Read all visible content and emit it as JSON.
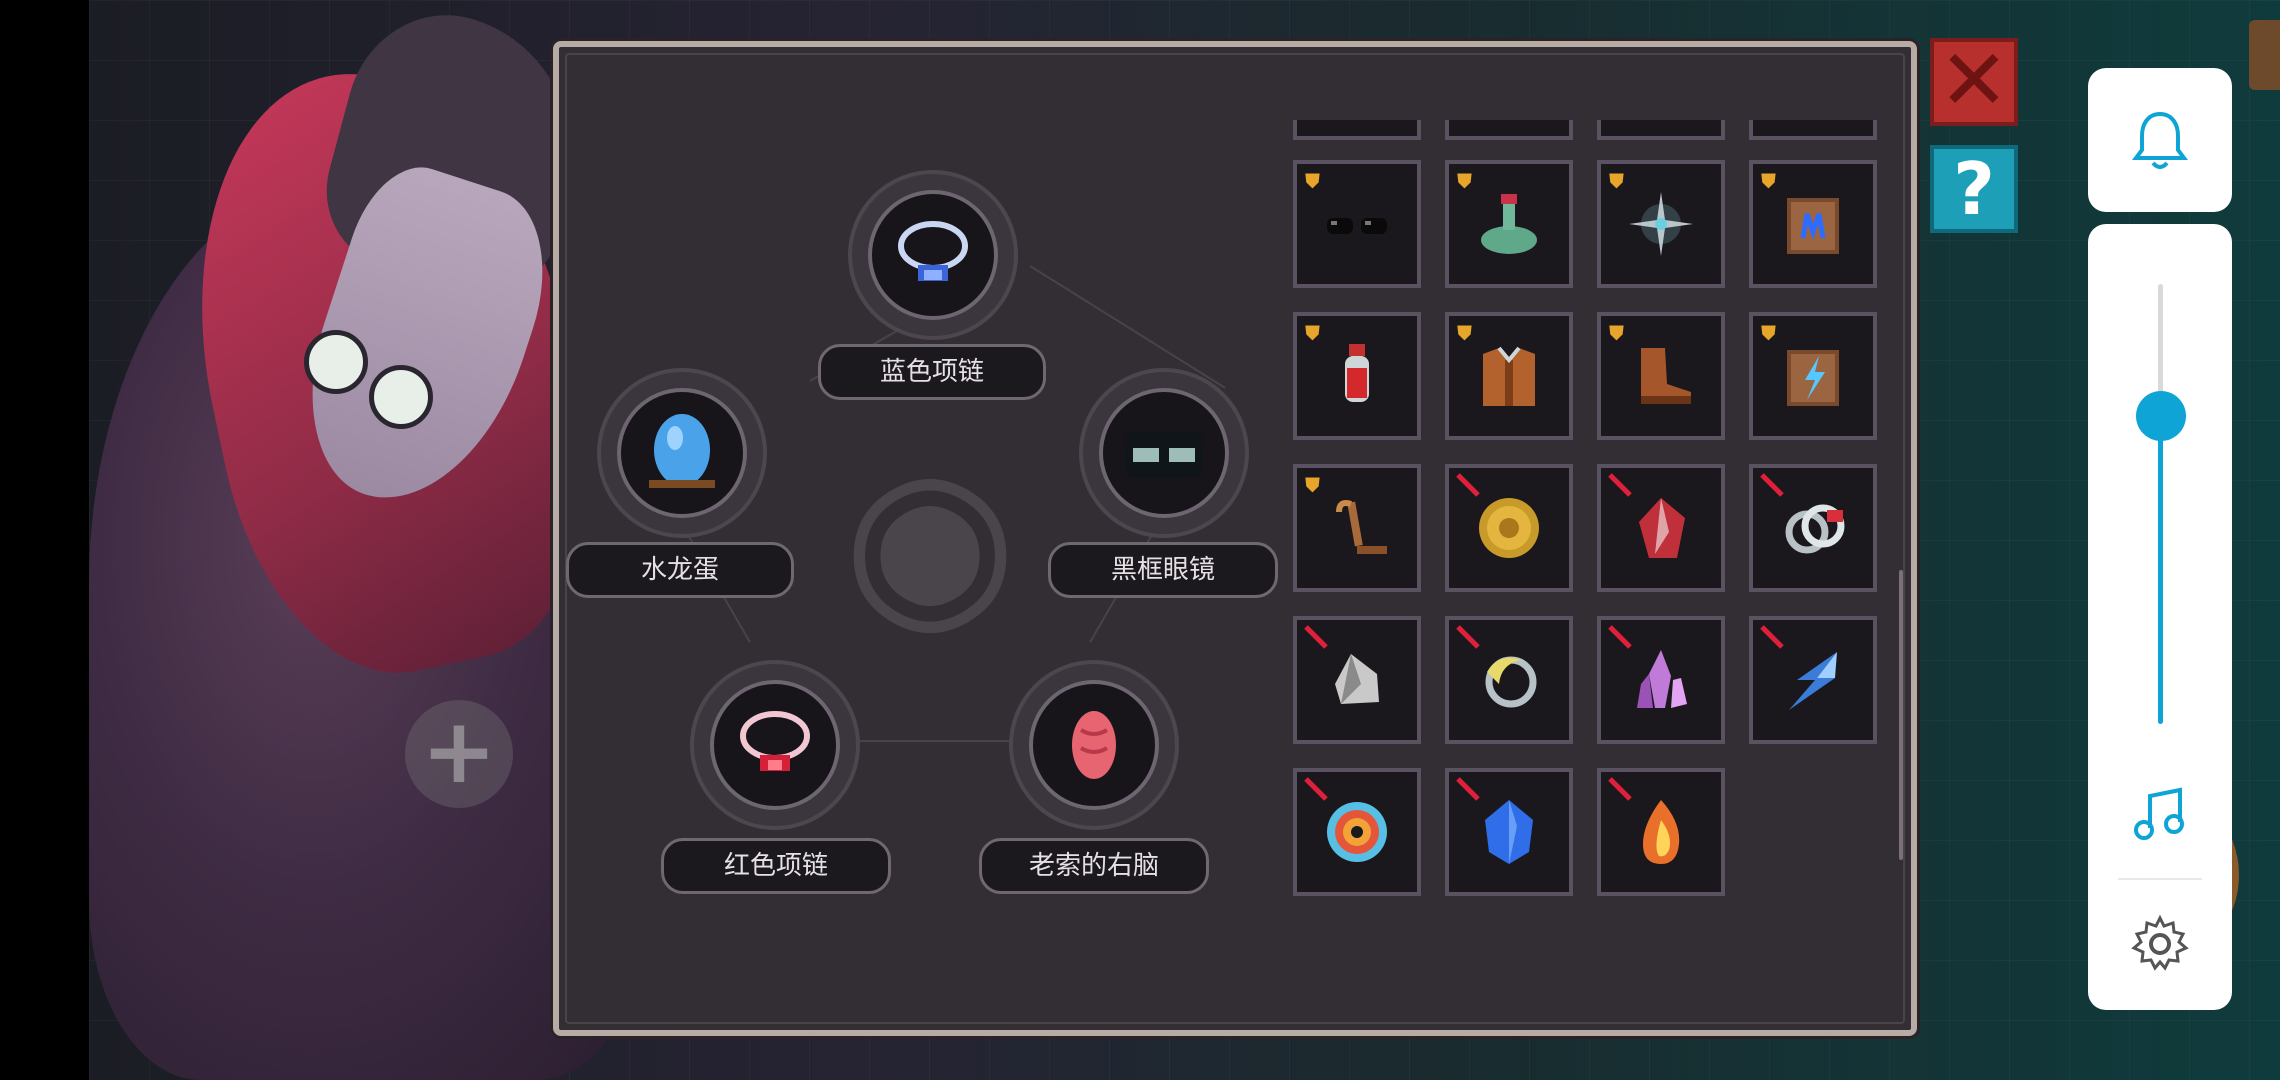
{
  "slots": {
    "top": {
      "label": "蓝色项链",
      "icon": "blue-necklace-icon"
    },
    "left": {
      "label": "水龙蛋",
      "icon": "water-dragon-egg-icon"
    },
    "right": {
      "label": "黑框眼镜",
      "icon": "black-frame-glasses-icon"
    },
    "bottom_left": {
      "label": "红色项链",
      "icon": "red-necklace-icon"
    },
    "bottom_right": {
      "label": "老索的右脑",
      "icon": "right-brain-icon"
    }
  },
  "items": [
    {
      "icon": "black-glasses-icon",
      "status": "owned"
    },
    {
      "icon": "green-snake-icon",
      "status": "owned"
    },
    {
      "icon": "star-compass-icon",
      "status": "owned"
    },
    {
      "icon": "blue-scroll-icon",
      "status": "owned"
    },
    {
      "icon": "red-potion-icon",
      "status": "owned"
    },
    {
      "icon": "leather-vest-icon",
      "status": "owned"
    },
    {
      "icon": "boot-icon",
      "status": "owned"
    },
    {
      "icon": "lightning-scroll-icon",
      "status": "owned"
    },
    {
      "icon": "wooden-cane-icon",
      "status": "owned"
    },
    {
      "icon": "gold-coin-icon",
      "status": "locked"
    },
    {
      "icon": "red-crystal-icon",
      "status": "locked"
    },
    {
      "icon": "silver-rings-icon",
      "status": "locked"
    },
    {
      "icon": "white-stone-icon",
      "status": "locked"
    },
    {
      "icon": "moon-ring-icon",
      "status": "locked"
    },
    {
      "icon": "purple-crystal-icon",
      "status": "locked"
    },
    {
      "icon": "blue-bolt-icon",
      "status": "locked"
    },
    {
      "icon": "target-icon",
      "status": "locked"
    },
    {
      "icon": "blue-gem-icon",
      "status": "locked"
    },
    {
      "icon": "fire-gem-icon",
      "status": "locked"
    }
  ],
  "volume": {
    "level": 0.7
  },
  "colors": {
    "accent": "#0ea4d6",
    "close": "#b8302d",
    "help": "#1d9fb8",
    "owned_badge": "#e7a52a",
    "locked_mark": "#e0203a"
  }
}
